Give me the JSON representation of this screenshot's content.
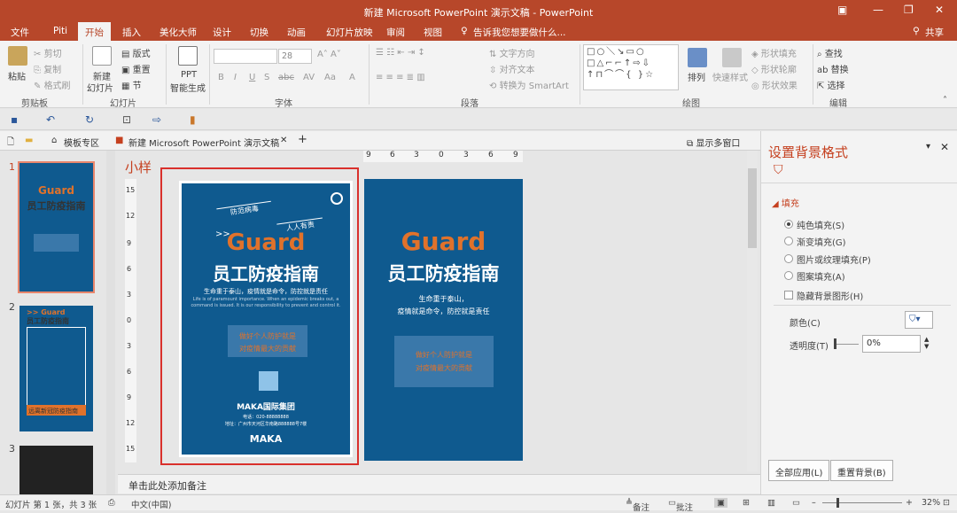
{
  "title_bar": {
    "title": "新建 Microsoft PowerPoint 演示文稿 - PowerPoint"
  },
  "tabs": [
    "文件",
    "Piti",
    "开始",
    "插入",
    "美化大师",
    "设计",
    "切换",
    "动画",
    "幻灯片放映",
    "审阅",
    "视图"
  ],
  "tell_me": "告诉我您想要做什么...",
  "share": "共享",
  "ribbon": {
    "clipboard": {
      "paste": "粘贴",
      "cut": "剪切",
      "copy": "复制",
      "format_painter": "格式刷",
      "label": "剪贴板"
    },
    "slides": {
      "new_slide": "新建",
      "new_slide2": "幻灯片",
      "layout": "版式",
      "reset": "重置",
      "section": "节",
      "label": "幻灯片"
    },
    "ppt": {
      "line1": "PPT",
      "line2": "智能生成"
    },
    "font": {
      "size": "28",
      "label": "字体",
      "buttons": [
        "B",
        "I",
        "U",
        "S",
        "abc",
        "AV",
        "Aa",
        "A"
      ]
    },
    "paragraph": {
      "text_direction": "文字方向",
      "align_text": "对齐文本",
      "smartart": "转换为 SmartArt",
      "label": "段落"
    },
    "drawing": {
      "shapes": "□○＼↘▭○ □△⌐⌐↑⇨⇩ ↑⊓⌒⌒{ }☆",
      "arrange": "排列",
      "quick_styles": "快速样式",
      "fill": "形状填充",
      "outline": "形状轮廓",
      "effects": "形状效果",
      "label": "绘图"
    },
    "editing": {
      "find": "查找",
      "replace": "替换",
      "select": "选择",
      "label": "编辑"
    }
  },
  "doc_tabs": {
    "template": "模板专区",
    "document": "新建 Microsoft PowerPoint 演示文稿",
    "multi_window": "显示多窗口"
  },
  "thumbnails": [
    {
      "num": "1",
      "guard": "Guard",
      "title": "员工防疫指南"
    },
    {
      "num": "2",
      "guard": ">> Guard",
      "title": "员工防疫指南",
      "banner": "远离新冠防疫指南"
    },
    {
      "num": "3"
    }
  ],
  "editor": {
    "label": "小样",
    "h_ruler": [
      "9",
      "6",
      "3",
      "0",
      "3",
      "6",
      "9"
    ],
    "v_ruler": [
      "15",
      "12",
      "9",
      "6",
      "3",
      "0",
      "3",
      "6",
      "9",
      "12",
      "15"
    ],
    "slide1": {
      "tag1": "防范病毒",
      "tag2": "人人有责",
      "arrows": ">>",
      "guard": "Guard",
      "title": "员工防疫指南",
      "sub1": "生命重于泰山，疫情就是命令，防控就是责任",
      "sub_en1": "Life is of paramount importance. When an epidemic breaks out, a",
      "sub_en2": "command is issued. It is our responsibility to prevent and control it.",
      "box1": "做好个人防护就是",
      "box2": "对疫情最大的贡献",
      "company": "MAKA国际集团",
      "contact1": "电话：020-88888888",
      "contact2": "地址：广州市天河区华南路888888号7楼",
      "logo": "MAKA"
    },
    "slide2": {
      "guard": "Guard",
      "title": "员工防疫指南",
      "sub1": "生命重于泰山，",
      "sub2": "疫情就是命令，防控就是责任",
      "box1": "做好个人防护就是",
      "box2": "对疫情最大的贡献"
    }
  },
  "notes": "单击此处添加备注",
  "pane": {
    "title": "设置背景格式",
    "section": "填充",
    "options": [
      "纯色填充(S)",
      "渐变填充(G)",
      "图片或纹理填充(P)",
      "图案填充(A)"
    ],
    "hide_bg": "隐藏背景图形(H)",
    "color_label": "颜色(C)",
    "transparency_label": "透明度(T)",
    "transparency_value": "0%",
    "apply_all": "全部应用(L)",
    "reset_bg": "重置背景(B)"
  },
  "status": {
    "slide_info": "幻灯片 第 1 张，共 3 张",
    "language": "中文(中国)",
    "notes": "备注",
    "comments": "批注",
    "zoom": "32%"
  }
}
